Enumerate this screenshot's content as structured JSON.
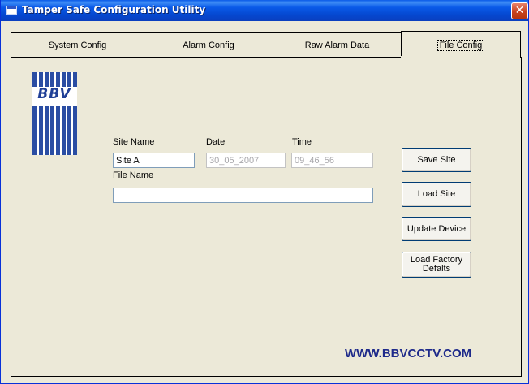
{
  "window": {
    "title": "Tamper Safe Configuration Utility",
    "close_glyph": "✕"
  },
  "tabs": [
    {
      "label": "System Config",
      "active": false
    },
    {
      "label": "Alarm Config",
      "active": false
    },
    {
      "label": "Raw Alarm Data",
      "active": false
    },
    {
      "label": "File Config",
      "active": true
    }
  ],
  "logo": {
    "text": "BBV"
  },
  "form": {
    "site_name": {
      "label": "Site Name",
      "value": "Site A"
    },
    "date": {
      "label": "Date",
      "value": "30_05_2007"
    },
    "time": {
      "label": "Time",
      "value": "09_46_56"
    },
    "file_name": {
      "label": "File Name",
      "value": ""
    }
  },
  "buttons": {
    "save_site": "Save Site",
    "load_site": "Load Site",
    "update_device": "Update Device",
    "load_factory_defaults": "Load Factory\nDefalts"
  },
  "website": "WWW.BBVCCTV.COM",
  "colors": {
    "titlebar": "#0a5ae8",
    "background": "#ece9d8",
    "website_text": "#1e2a8a",
    "logo_blue": "#2a4da3"
  }
}
